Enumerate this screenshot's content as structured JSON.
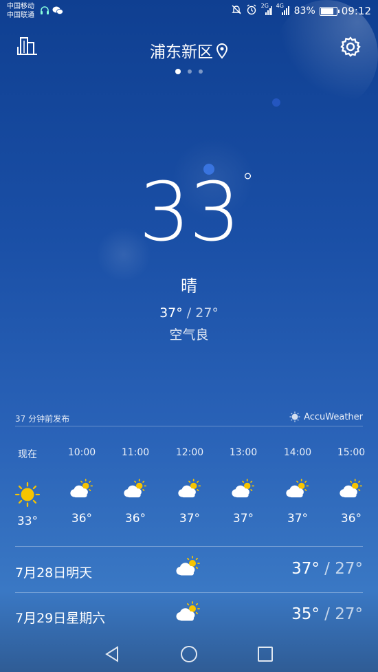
{
  "status_bar": {
    "carrier_1": "中国移动",
    "carrier_2": "中国联通",
    "net_2g": "2G",
    "net_4g": "4G",
    "battery": "83%",
    "battery_level": 0.83,
    "time": "09:12"
  },
  "header": {
    "city": "浦东新区",
    "page_dots": 3,
    "active_page": 0
  },
  "current": {
    "temperature": "33",
    "degree": "°",
    "condition": "晴",
    "high": "37°",
    "separator": " / ",
    "low": "27°",
    "air_quality": "空气良"
  },
  "hourly_meta": {
    "published": "37 分钟前发布",
    "provider": "AccuWeather"
  },
  "hourly": [
    {
      "time": "现在",
      "icon": "sun-icon",
      "temp": "33°"
    },
    {
      "time": "10:00",
      "icon": "partly-cloudy-icon",
      "temp": "36°"
    },
    {
      "time": "11:00",
      "icon": "partly-cloudy-icon",
      "temp": "36°"
    },
    {
      "time": "12:00",
      "icon": "partly-cloudy-icon",
      "temp": "37°"
    },
    {
      "time": "13:00",
      "icon": "partly-cloudy-icon",
      "temp": "37°"
    },
    {
      "time": "14:00",
      "icon": "partly-cloudy-icon",
      "temp": "37°"
    },
    {
      "time": "15:00",
      "icon": "partly-cloudy-icon",
      "temp": "36°"
    }
  ],
  "daily": [
    {
      "date": "7月28日明天",
      "icon": "partly-cloudy-icon",
      "high": "37°",
      "low": "27°"
    },
    {
      "date": "7月29日星期六",
      "icon": "partly-cloudy-icon",
      "high": "35°",
      "low": "27°"
    }
  ],
  "colors": {
    "sun": "#f7c400",
    "cloud": "#ffffff"
  }
}
